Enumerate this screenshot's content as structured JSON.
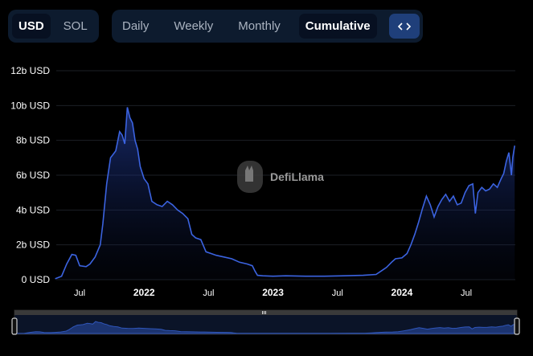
{
  "currency_toggle": {
    "options": [
      "USD",
      "SOL"
    ],
    "selected": "USD"
  },
  "period_toggle": {
    "options": [
      "Daily",
      "Weekly",
      "Monthly",
      "Cumulative"
    ],
    "selected": "Cumulative"
  },
  "embed_icon": "code-icon",
  "watermark": {
    "text": "DefiLlama",
    "icon": "llama-logo-icon"
  },
  "chart_data": {
    "type": "area",
    "series": [
      {
        "values": [
          [
            2021.31,
            0.05
          ],
          [
            2021.36,
            0.2
          ],
          [
            2021.4,
            0.9
          ],
          [
            2021.44,
            1.45
          ],
          [
            2021.47,
            1.4
          ],
          [
            2021.5,
            0.8
          ],
          [
            2021.55,
            0.75
          ],
          [
            2021.58,
            0.9
          ],
          [
            2021.62,
            1.3
          ],
          [
            2021.66,
            2.0
          ],
          [
            2021.68,
            3.2
          ],
          [
            2021.71,
            5.5
          ],
          [
            2021.74,
            7.0
          ],
          [
            2021.76,
            7.2
          ],
          [
            2021.78,
            7.4
          ],
          [
            2021.81,
            8.5
          ],
          [
            2021.83,
            8.3
          ],
          [
            2021.85,
            7.8
          ],
          [
            2021.87,
            9.9
          ],
          [
            2021.89,
            9.3
          ],
          [
            2021.91,
            9.0
          ],
          [
            2021.93,
            8.0
          ],
          [
            2021.95,
            7.5
          ],
          [
            2021.97,
            6.5
          ],
          [
            2022.0,
            5.8
          ],
          [
            2022.03,
            5.5
          ],
          [
            2022.06,
            4.5
          ],
          [
            2022.1,
            4.3
          ],
          [
            2022.14,
            4.2
          ],
          [
            2022.18,
            4.5
          ],
          [
            2022.22,
            4.3
          ],
          [
            2022.26,
            4.0
          ],
          [
            2022.3,
            3.8
          ],
          [
            2022.34,
            3.5
          ],
          [
            2022.37,
            2.6
          ],
          [
            2022.4,
            2.4
          ],
          [
            2022.44,
            2.3
          ],
          [
            2022.48,
            1.6
          ],
          [
            2022.52,
            1.5
          ],
          [
            2022.56,
            1.4
          ],
          [
            2022.62,
            1.3
          ],
          [
            2022.68,
            1.2
          ],
          [
            2022.74,
            1.0
          ],
          [
            2022.8,
            0.9
          ],
          [
            2022.84,
            0.8
          ],
          [
            2022.86,
            0.5
          ],
          [
            2022.88,
            0.25
          ],
          [
            2022.92,
            0.22
          ],
          [
            2023.0,
            0.2
          ],
          [
            2023.1,
            0.22
          ],
          [
            2023.25,
            0.2
          ],
          [
            2023.4,
            0.2
          ],
          [
            2023.55,
            0.22
          ],
          [
            2023.7,
            0.25
          ],
          [
            2023.8,
            0.3
          ],
          [
            2023.85,
            0.55
          ],
          [
            2023.88,
            0.7
          ],
          [
            2023.92,
            1.0
          ],
          [
            2023.95,
            1.2
          ],
          [
            2024.0,
            1.25
          ],
          [
            2024.04,
            1.5
          ],
          [
            2024.07,
            2.0
          ],
          [
            2024.1,
            2.6
          ],
          [
            2024.13,
            3.3
          ],
          [
            2024.16,
            4.1
          ],
          [
            2024.19,
            4.8
          ],
          [
            2024.22,
            4.3
          ],
          [
            2024.25,
            3.6
          ],
          [
            2024.28,
            4.2
          ],
          [
            2024.31,
            4.6
          ],
          [
            2024.34,
            4.9
          ],
          [
            2024.37,
            4.5
          ],
          [
            2024.4,
            4.8
          ],
          [
            2024.43,
            4.3
          ],
          [
            2024.46,
            4.4
          ],
          [
            2024.49,
            5.0
          ],
          [
            2024.52,
            5.4
          ],
          [
            2024.55,
            5.5
          ],
          [
            2024.57,
            3.8
          ],
          [
            2024.59,
            5.0
          ],
          [
            2024.62,
            5.3
          ],
          [
            2024.65,
            5.1
          ],
          [
            2024.68,
            5.2
          ],
          [
            2024.71,
            5.5
          ],
          [
            2024.74,
            5.3
          ],
          [
            2024.77,
            5.8
          ],
          [
            2024.79,
            6.1
          ],
          [
            2024.81,
            6.8
          ],
          [
            2024.83,
            7.3
          ],
          [
            2024.85,
            6.0
          ],
          [
            2024.86,
            7.0
          ],
          [
            2024.875,
            7.7
          ]
        ]
      }
    ],
    "x_ticks": [
      {
        "value": 2021.5,
        "label": "Jul",
        "bold": false
      },
      {
        "value": 2022.0,
        "label": "2022",
        "bold": true
      },
      {
        "value": 2022.5,
        "label": "Jul",
        "bold": false
      },
      {
        "value": 2023.0,
        "label": "2023",
        "bold": true
      },
      {
        "value": 2023.5,
        "label": "Jul",
        "bold": false
      },
      {
        "value": 2024.0,
        "label": "2024",
        "bold": true
      },
      {
        "value": 2024.5,
        "label": "Jul",
        "bold": false
      }
    ],
    "y_ticks": [
      {
        "value": 0,
        "label": "0 USD"
      },
      {
        "value": 2,
        "label": "2b USD"
      },
      {
        "value": 4,
        "label": "4b USD"
      },
      {
        "value": 6,
        "label": "6b USD"
      },
      {
        "value": 8,
        "label": "8b USD"
      },
      {
        "value": 10,
        "label": "10b USD"
      },
      {
        "value": 12,
        "label": "12b USD"
      }
    ],
    "xlim": [
      2021.3,
      2024.88
    ],
    "ylim": [
      0,
      12
    ],
    "grid": true,
    "line_color": "#3b63e0",
    "brush_handle_icon": "grip-icon"
  }
}
